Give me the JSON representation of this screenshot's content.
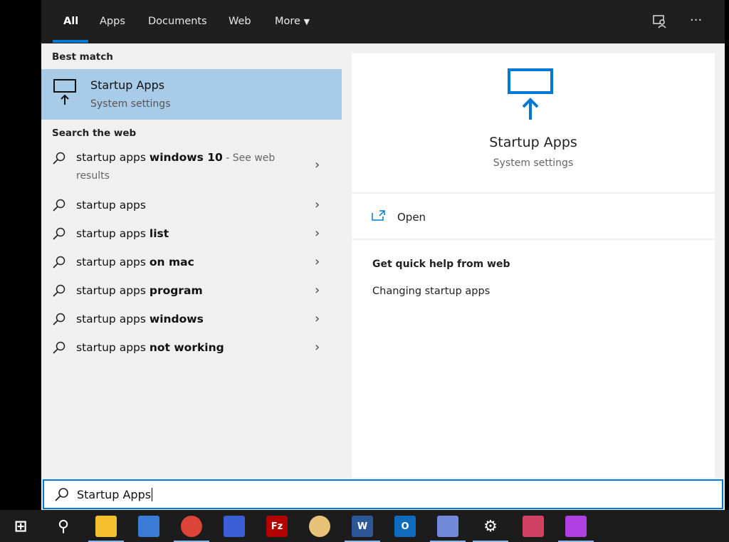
{
  "tabs": [
    {
      "label": "All"
    },
    {
      "label": "Apps"
    },
    {
      "label": "Documents"
    },
    {
      "label": "Web"
    },
    {
      "label": "More"
    }
  ],
  "header_icons": [
    "feedback-icon",
    "more-options-icon"
  ],
  "more_label": "···",
  "best_match": {
    "heading": "Best match",
    "title": "Startup Apps",
    "subtitle": "System settings"
  },
  "web": {
    "heading": "Search the web",
    "items": [
      {
        "plain": "startup apps ",
        "bold": "windows 10",
        "suffix": " - See web results"
      },
      {
        "plain": "startup apps",
        "bold": "",
        "suffix": ""
      },
      {
        "plain": "startup apps ",
        "bold": "list",
        "suffix": ""
      },
      {
        "plain": "startup apps ",
        "bold": "on mac",
        "suffix": ""
      },
      {
        "plain": "startup apps ",
        "bold": "program",
        "suffix": ""
      },
      {
        "plain": "startup apps ",
        "bold": "windows",
        "suffix": ""
      },
      {
        "plain": "startup apps ",
        "bold": "not working",
        "suffix": ""
      }
    ]
  },
  "detail": {
    "title": "Startup Apps",
    "subtitle": "System settings",
    "open_label": "Open",
    "help_heading": "Get quick help from web",
    "help_link": "Changing startup apps"
  },
  "search": {
    "value": "Startup Apps"
  },
  "taskbar": [
    "start",
    "search",
    "file-explorer",
    "remote-desktop",
    "chrome",
    "network",
    "filezilla",
    "paint",
    "word",
    "outlook",
    "discord",
    "settings",
    "snipping-tool",
    "paint-3d"
  ],
  "colors": {
    "accent": "#0078d7",
    "selection": "#a8cbe8"
  }
}
